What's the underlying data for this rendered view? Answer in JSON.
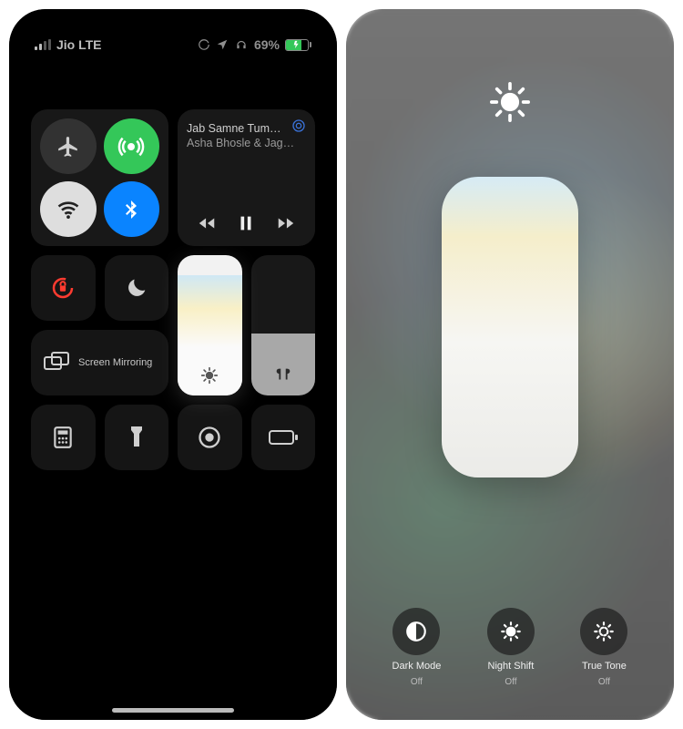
{
  "statusbar": {
    "carrier": "Jio LTE",
    "battery_pct": "69%"
  },
  "media": {
    "title": "Jab Samne Tum…",
    "artist": "Asha Bhosle & Jag…"
  },
  "mirror_label": "Screen Mirroring",
  "brightness_module": {
    "options": [
      {
        "label": "Dark Mode",
        "state": "Off"
      },
      {
        "label": "Night Shift",
        "state": "Off"
      },
      {
        "label": "True Tone",
        "state": "Off"
      }
    ]
  }
}
